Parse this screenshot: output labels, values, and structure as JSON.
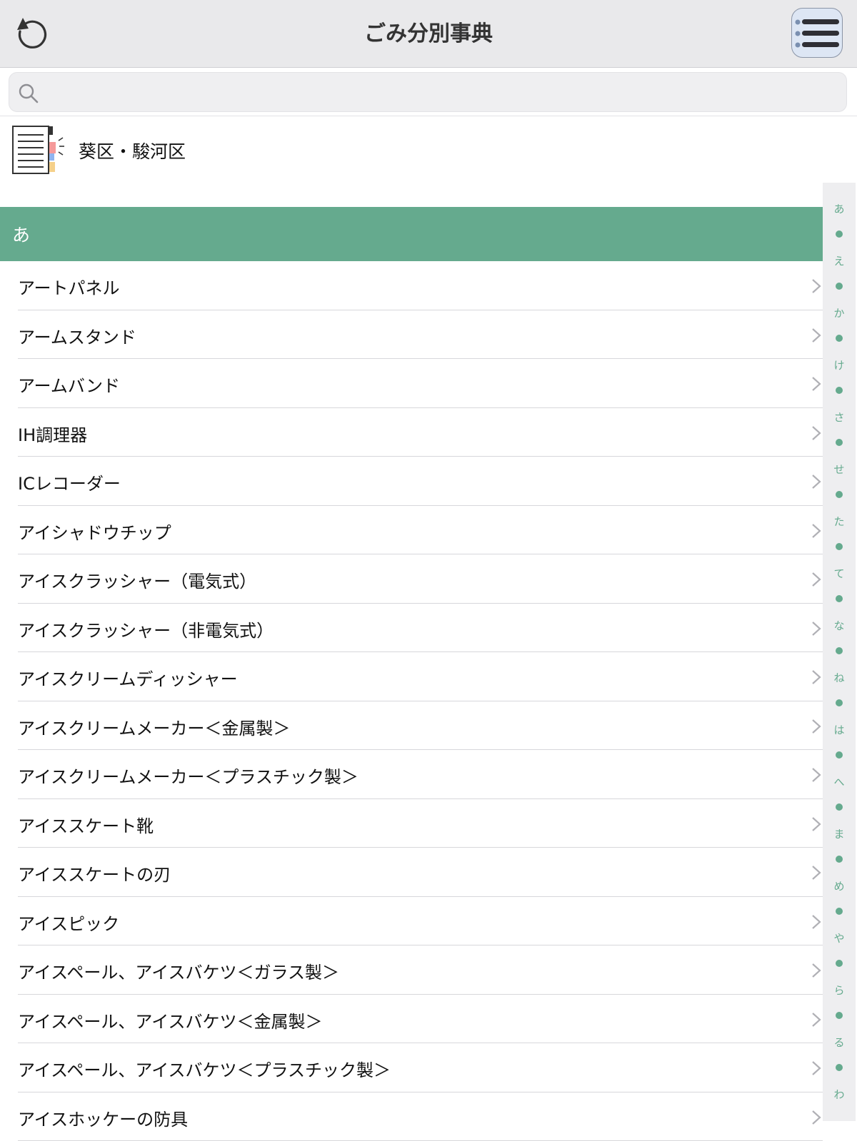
{
  "app": {
    "title": "ごみ分別事典"
  },
  "search": {
    "value": "",
    "placeholder": ""
  },
  "district": {
    "label": "葵区・駿河区"
  },
  "section": {
    "header": "あ"
  },
  "items": [
    "アートパネル",
    "アームスタンド",
    "アームバンド",
    "IH調理器",
    "ICレコーダー",
    "アイシャドウチップ",
    "アイスクラッシャー（電気式）",
    "アイスクラッシャー（非電気式）",
    "アイスクリームディッシャー",
    "アイスクリームメーカー＜金属製＞",
    "アイスクリームメーカー＜プラスチック製＞",
    "アイススケート靴",
    "アイススケートの刃",
    "アイスピック",
    "アイスペール、アイスバケツ＜ガラス製＞",
    "アイスペール、アイスバケツ＜金属製＞",
    "アイスペール、アイスバケツ＜プラスチック製＞",
    "アイスホッケーの防具"
  ],
  "index": [
    "あ",
    "え",
    "か",
    "け",
    "さ",
    "せ",
    "た",
    "て",
    "な",
    "ね",
    "は",
    "へ",
    "ま",
    "め",
    "や",
    "ら",
    "る",
    "わ"
  ],
  "colors": {
    "accent": "#65aa8e",
    "navbar": "#e9e9eb"
  }
}
